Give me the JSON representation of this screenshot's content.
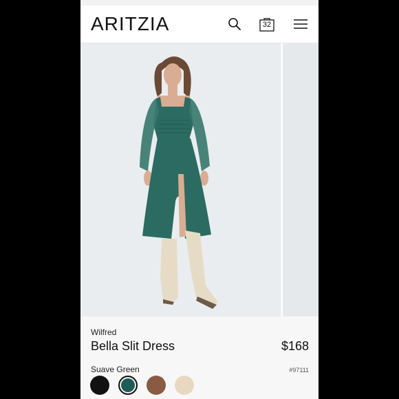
{
  "header": {
    "logo": "ARITZIA",
    "bag_count": "32"
  },
  "icons": {
    "search": "search-icon",
    "bag": "shopping-bag-icon",
    "menu": "hamburger-menu-icon"
  },
  "product": {
    "brand": "Wilfred",
    "name": "Bella Slit Dress",
    "price": "$168",
    "color_name": "Suave Green",
    "sku": "#97111",
    "swatches": [
      {
        "name": "black",
        "color": "#111111",
        "selected": false
      },
      {
        "name": "suave-green",
        "color": "#1d5c57",
        "selected": true
      },
      {
        "name": "brown",
        "color": "#8a5b43",
        "selected": false
      },
      {
        "name": "cream",
        "color": "#e8d8c2",
        "selected": false
      }
    ]
  },
  "colors": {
    "background": "#000000",
    "dress": "#2b6b62",
    "boots": "#e6dcc6"
  }
}
